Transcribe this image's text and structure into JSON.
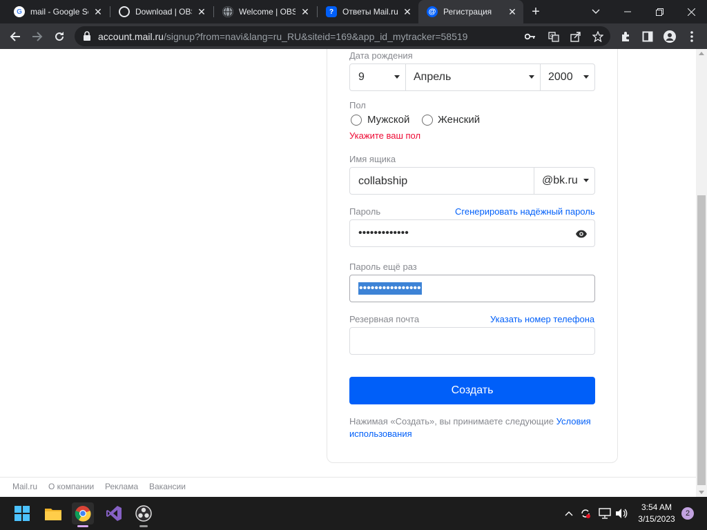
{
  "browser": {
    "tabs": [
      {
        "title": "mail - Google Se",
        "icon": "google-icon"
      },
      {
        "title": "Download | OBS",
        "icon": "obs-icon"
      },
      {
        "title": "Welcome | OBS",
        "icon": "globe-icon"
      },
      {
        "title": "Ответы Mail.ru",
        "icon": "question-icon"
      },
      {
        "title": "Регистрация",
        "icon": "mail-at-icon",
        "active": true
      }
    ],
    "url_host": "account.mail.ru",
    "url_path": "/signup?from=navi&lang=ru_RU&siteid=169&app_id_mytracker=58519"
  },
  "form": {
    "birth_date": {
      "label": "Дата рождения",
      "day": "9",
      "month": "Апрель",
      "year": "2000"
    },
    "gender": {
      "label": "Пол",
      "male": "Мужской",
      "female": "Женский",
      "error": "Укажите ваш пол"
    },
    "mailbox": {
      "label": "Имя ящика",
      "value": "collabship",
      "domain": "@bk.ru"
    },
    "password": {
      "label": "Пароль",
      "generate_link": "Сгенерировать надёжный пароль",
      "masked": "•••••••••••••"
    },
    "password_repeat": {
      "label": "Пароль ещё раз",
      "masked": "••••••••••••••••"
    },
    "backup_email": {
      "label": "Резервная почта",
      "phone_link": "Указать номер телефона",
      "value": ""
    },
    "submit_label": "Создать",
    "terms_text": "Нажимая «Создать», вы принимаете следующие ",
    "terms_link_1": "Условия",
    "terms_link_2": "использования"
  },
  "footer": {
    "links": [
      "Mail.ru",
      "О компании",
      "Реклама",
      "Вакансии"
    ]
  },
  "taskbar": {
    "time": "3:54 AM",
    "date": "3/15/2023",
    "notifications": "2"
  },
  "colors": {
    "accent": "#005ff9",
    "error": "#ed0a34",
    "label": "#87898f"
  }
}
